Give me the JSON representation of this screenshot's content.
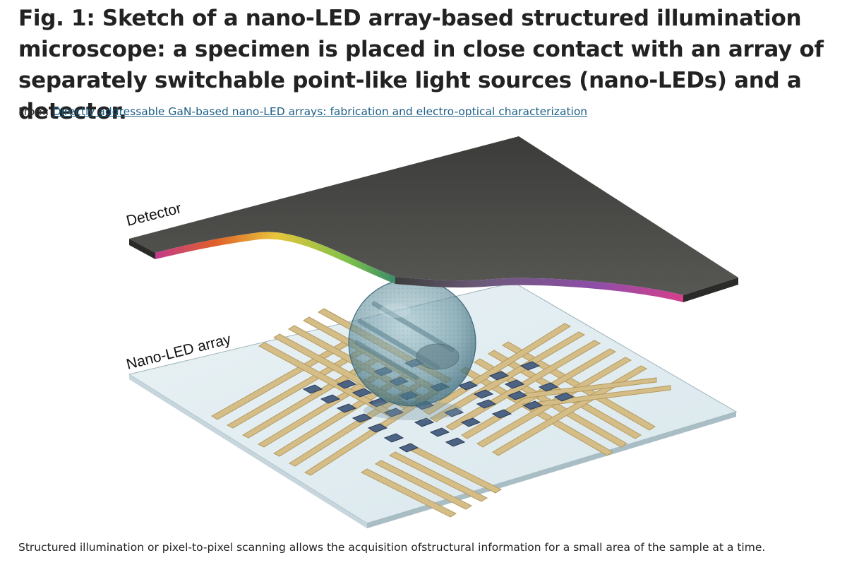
{
  "figure": {
    "title": "Fig. 1: Sketch of a nano-LED array-based structured illumination microscope: a specimen is placed in close contact with an array of separately switchable point-like light sources (nano-LEDs) and a detector.",
    "source_prefix": "From: ",
    "source_link_text": "Directly addressable GaN-based nano-LED arrays: fabrication and electro-optical characterization",
    "labels": {
      "detector": "Detector",
      "array": "Nano-LED array"
    },
    "caption": "Structured illumination or pixel-to-pixel scanning allows the acquisition ofstructural information for a small area of the sample at a time."
  },
  "colors": {
    "detector_top": "#4a4a48",
    "substrate": "#e4eef2",
    "electrode": "#cdb37c",
    "led": "#4a5f7e",
    "sphere": "#6a96a4",
    "link": "#1d5f86"
  }
}
